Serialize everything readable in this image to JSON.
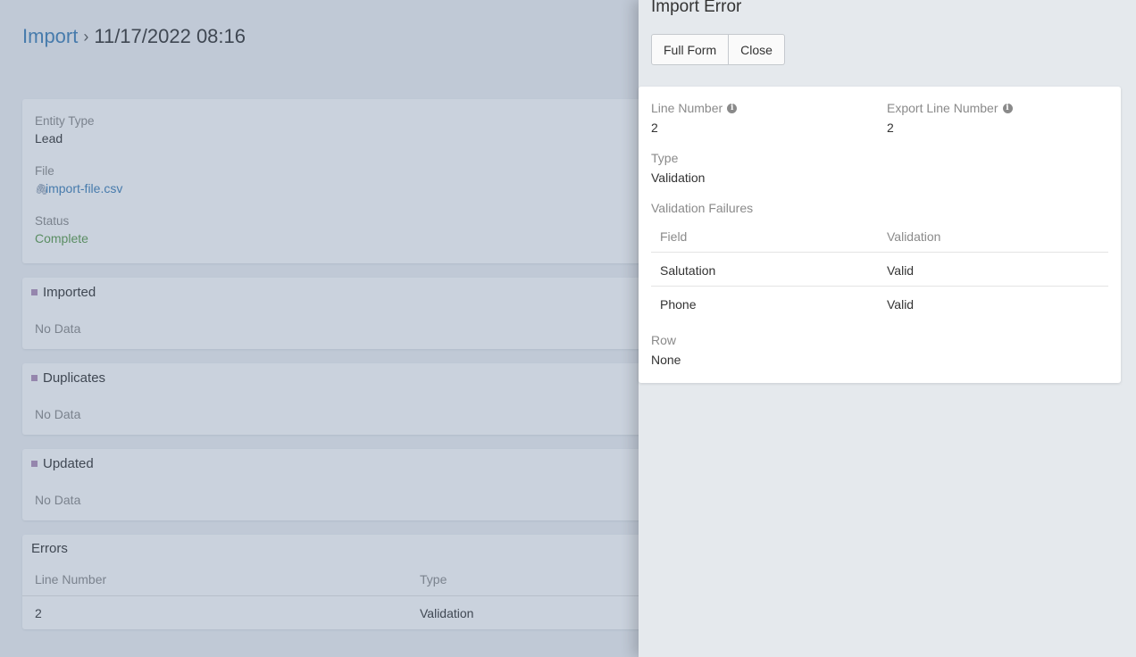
{
  "breadcrumb": {
    "root": "Import",
    "separator": "›",
    "current": "11/17/2022 08:16"
  },
  "record": {
    "entity_type_label": "Entity Type",
    "entity_type_value": "Lead",
    "file_label": "File",
    "file_value": "import-file.csv",
    "status_label": "Status",
    "status_value": "Complete"
  },
  "panels": {
    "imported": {
      "title": "Imported",
      "empty": "No Data"
    },
    "duplicates": {
      "title": "Duplicates",
      "empty": "No Data"
    },
    "updated": {
      "title": "Updated",
      "empty": "No Data"
    }
  },
  "errors": {
    "title": "Errors",
    "columns": [
      "Line Number",
      "Type"
    ],
    "rows": [
      {
        "line_number": "2",
        "type": "Validation"
      }
    ]
  },
  "modal": {
    "title": "Import Error",
    "buttons": {
      "full_form": "Full Form",
      "close": "Close"
    },
    "line_number_label": "Line Number",
    "line_number_value": "2",
    "export_line_number_label": "Export Line Number",
    "export_line_number_value": "2",
    "type_label": "Type",
    "type_value": "Validation",
    "validation_failures_label": "Validation Failures",
    "validation_columns": [
      "Field",
      "Validation"
    ],
    "validation_rows": [
      {
        "field": "Salutation",
        "validation": "Valid"
      },
      {
        "field": "Phone",
        "validation": "Valid"
      }
    ],
    "row_label": "Row",
    "row_value": "None"
  },
  "colors": {
    "link": "#3f7fb7",
    "status_complete": "#5a9a4a",
    "panel_marker": "#b28fb8",
    "side_panel_bg": "#e5e9ed"
  },
  "icons": {
    "file": "paperclip-icon",
    "info": "info-icon",
    "panel": "square-icon"
  }
}
